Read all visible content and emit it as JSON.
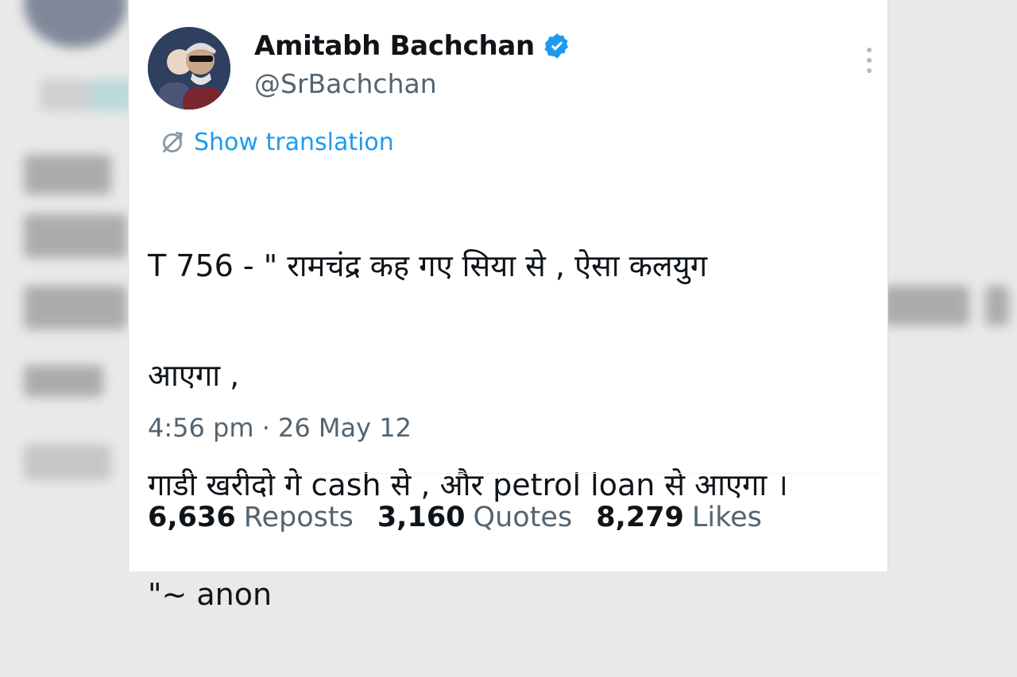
{
  "tweet": {
    "author": {
      "display_name": "Amitabh Bachchan",
      "handle": "@SrBachchan",
      "verified": true
    },
    "translate_label": "Show translation",
    "text_lines": [
      "T 756 - \" रामचंद्र कह गए सिया से , ऐसा कलयुग",
      "आएगा ,",
      "गाडी खरीदो गे cash से , और petrol loan से आएगा  ।",
      "\"~ anon"
    ],
    "timestamp": "4:56 pm · 26 May 12",
    "stats": [
      {
        "count": "6,636",
        "label": "Reposts"
      },
      {
        "count": "3,160",
        "label": "Quotes"
      },
      {
        "count": "8,279",
        "label": "Likes"
      }
    ]
  },
  "colors": {
    "accent": "#1d9bf0",
    "text": "#0f1419",
    "muted": "#536471"
  },
  "icons": {
    "verified": "verified-badge-icon",
    "translate": "translate-icon",
    "more": "more-options-icon"
  }
}
